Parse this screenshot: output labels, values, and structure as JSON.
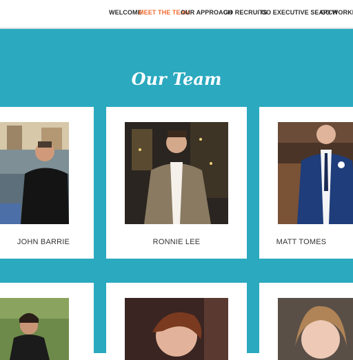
{
  "nav": {
    "items": [
      "WELCOME",
      "MEET THE TEAM",
      "OUR APPROACH",
      "GO RECRUITS",
      "GO EXECUTIVE SEARCH",
      "GO WORKFORC"
    ]
  },
  "page": {
    "title": "Our Team"
  },
  "team": {
    "row1": [
      "JOHN BARRIE",
      "RONNIE LEE",
      "MATT TOMES"
    ]
  },
  "colors": {
    "accent": "#f26a2e",
    "band": "#2aa9bf"
  },
  "icons": [
    "person-photo"
  ]
}
